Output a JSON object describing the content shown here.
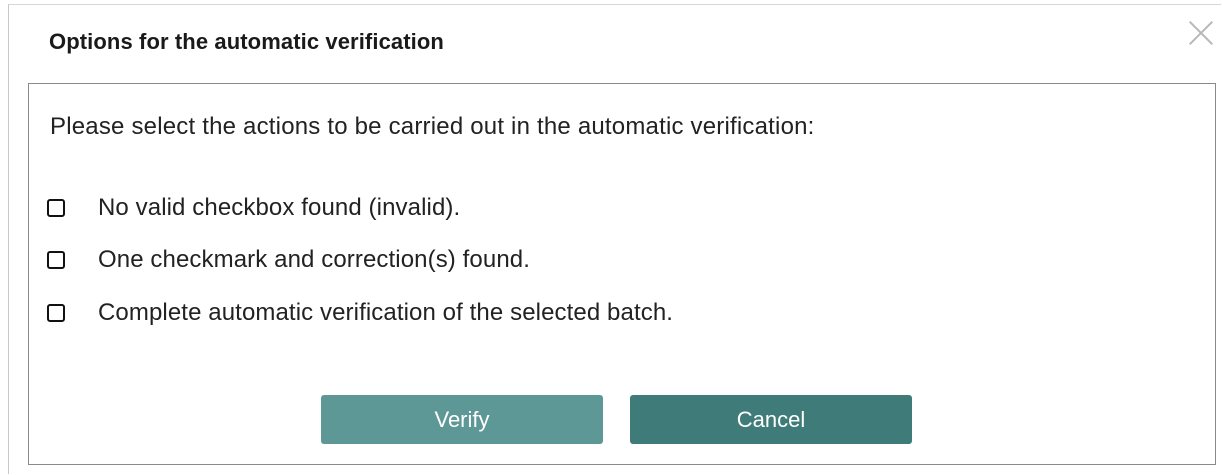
{
  "dialog": {
    "title": "Options for the automatic verification",
    "close_icon": "close-icon",
    "prompt": "Please select the actions to be carried out in the automatic verification:",
    "options": [
      {
        "label": "No valid checkbox found (invalid).",
        "checked": false
      },
      {
        "label": "One checkmark and correction(s) found.",
        "checked": false
      },
      {
        "label": "Complete automatic verification of the selected batch.",
        "checked": false
      }
    ],
    "buttons": {
      "verify_label": "Verify",
      "cancel_label": "Cancel"
    },
    "colors": {
      "verify_button": "#5e9896",
      "cancel_button": "#3f7c79",
      "panel_border": "#8a8a8a"
    }
  }
}
